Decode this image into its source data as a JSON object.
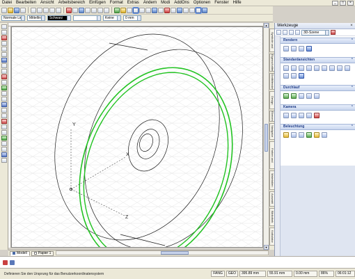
{
  "menubar": {
    "items": [
      "Datei",
      "Bearbeiten",
      "Ansicht",
      "Arbeitsbereich",
      "Einfügen",
      "Format",
      "Extras",
      "Ändern",
      "Modi",
      "AddOns",
      "Optionen",
      "Fenster",
      "Hilfe"
    ]
  },
  "toolbar2": {
    "line_style": "Normale Linie",
    "line_weight": "Mittellin",
    "color": "Schwarz",
    "fill": "Keine",
    "thickness": "0 mm"
  },
  "canvas": {
    "axis_y": "Y",
    "axis_x": "X",
    "axis_z": "Z"
  },
  "bottom_tabs": {
    "model": "Modell",
    "paper": "Papier 1"
  },
  "status": {
    "message": "Definieren Sie den Ursprung für das Benutzerkoordinatensystem",
    "mode": "FANG",
    "geo": "GEO",
    "x": "395.89 mm",
    "y": "55.91 mm",
    "z": "0.00 mm",
    "zoom": "86%",
    "time": "06:01:12"
  },
  "palette": {
    "title": "Werkzeuge",
    "scene": "3D-Szene",
    "sections": {
      "rendern": "Rendern",
      "standard": "Standardansichten",
      "durchlauf": "Durchlauf",
      "kamera": "Kamera",
      "beleuchtung": "Beleuchtung"
    },
    "side_tab": "Werkzeuge"
  },
  "side_tabs": [
    "Symbole und Teile",
    "Eigenschaften",
    "Grafikfenster",
    "Design Center",
    "Ebenen",
    "Navigator",
    "Farben und Füllungen",
    "Materialien",
    "Auswahl",
    "Bibliothek",
    "Kalkulator"
  ],
  "colors": {
    "ring": "#22c322",
    "grid": "#e8e8e8",
    "cyl": "#000000",
    "axis": "#333333"
  },
  "icons": {
    "close": "close-icon",
    "minimize": "minimize-icon",
    "maximize": "maximize-icon"
  }
}
